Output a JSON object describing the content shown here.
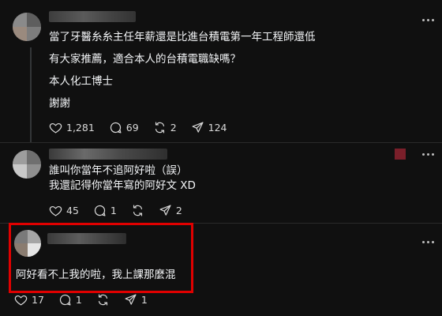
{
  "post1": {
    "lines": [
      "當了牙醫糸糸主任年薪還是比進台積電第一年工程師還低",
      "有大家推薦，適合本人的台積電職缺嗎？",
      "本人化工博士",
      "謝謝"
    ],
    "likes": "1,281",
    "comments": "69",
    "reposts": "2",
    "shares": "124"
  },
  "post2": {
    "lines": [
      "誰叫你當年不追阿好啦（誤）",
      "我還記得你當年寫的阿好文 XD"
    ],
    "likes": "45",
    "comments": "1",
    "reposts": "",
    "shares": "2"
  },
  "post3": {
    "lines": [
      "阿好看不上我的啦，我上課那麼混"
    ],
    "likes": "17",
    "comments": "1",
    "reposts": "",
    "shares": "1"
  },
  "icons": {
    "like": "heart-icon",
    "comment": "comment-icon",
    "repost": "repost-icon",
    "share": "share-icon",
    "more": "more-icon"
  },
  "colors": {
    "background": "#101010",
    "text": "#f3f5f7",
    "highlight": "#e00000"
  }
}
